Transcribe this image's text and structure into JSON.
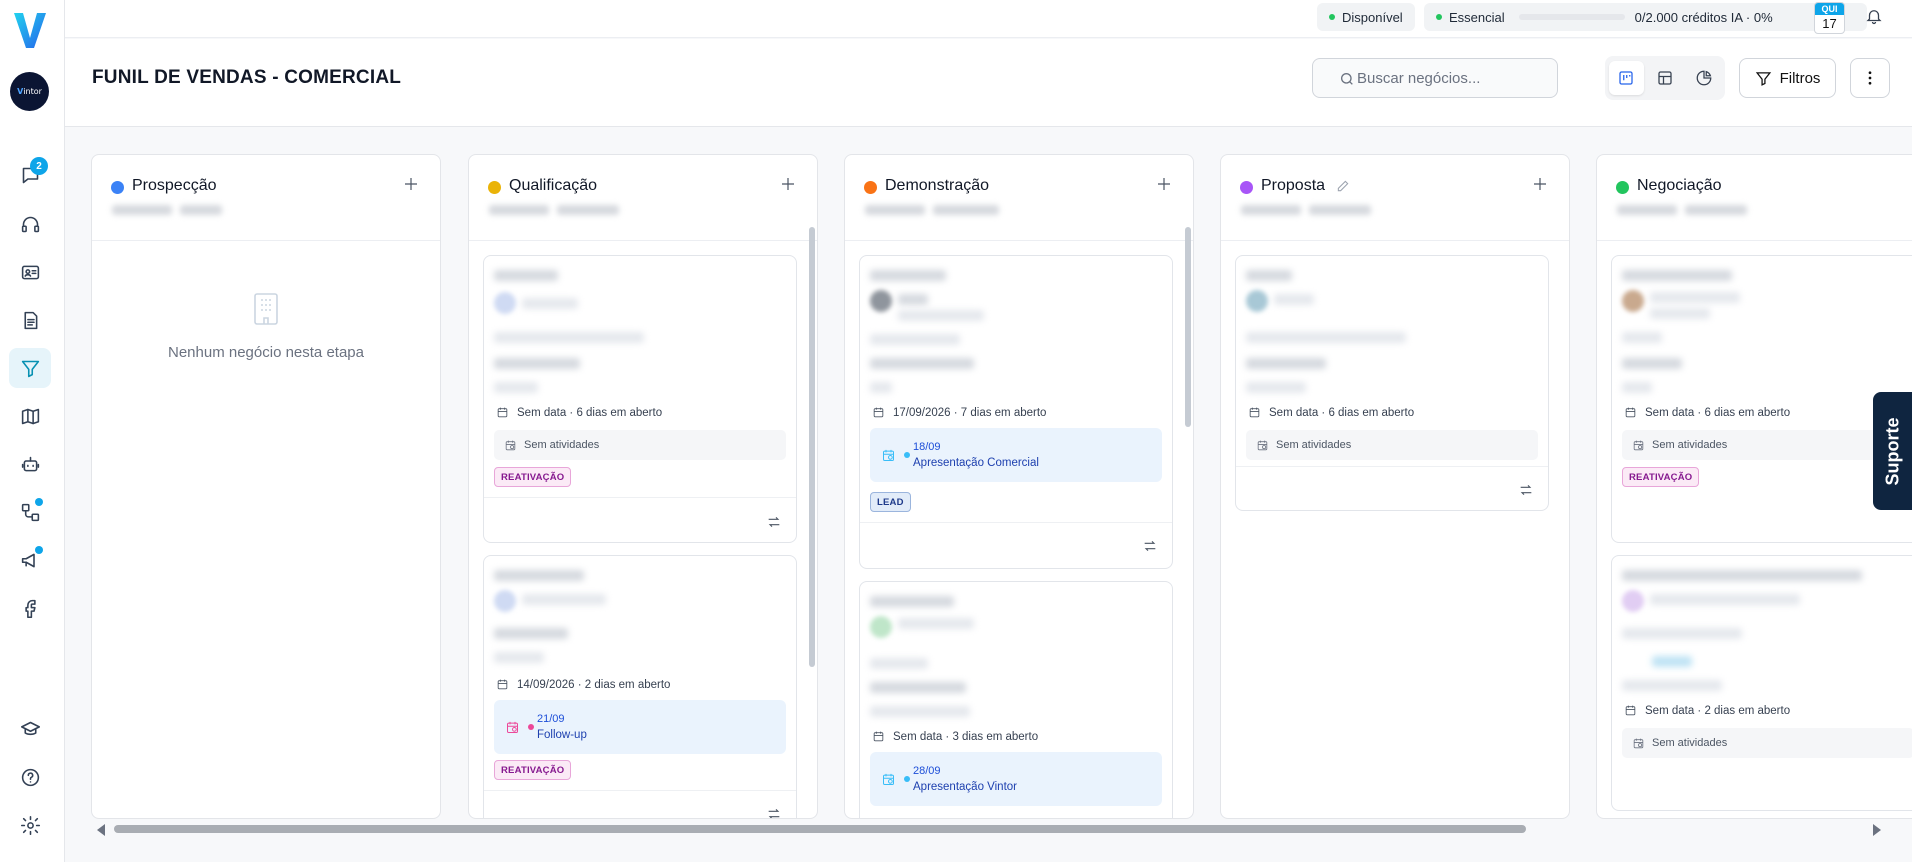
{
  "topbar": {
    "status_label": "Disponível",
    "plan_label": "Essencial",
    "credits_label": "0/2.000 créditos IA · 0%",
    "credits_progress": 0,
    "date_weekday": "QUI",
    "date_day": "17"
  },
  "sidebar": {
    "avatar_text_1": "V",
    "avatar_text_2": "intor",
    "notification_count": "2"
  },
  "header": {
    "title": "FUNIL DE VENDAS - COMERCIAL",
    "search_placeholder": "Buscar negócios...",
    "filters_label": "Filtros"
  },
  "columns": [
    {
      "title": "Prospecção",
      "color": "#3b82f6",
      "empty_text": "Nenhum negócio nesta etapa"
    },
    {
      "title": "Qualificação",
      "color": "#eab308"
    },
    {
      "title": "Demonstração",
      "color": "#f97316"
    },
    {
      "title": "Proposta",
      "color": "#a855f7"
    },
    {
      "title": "Negociação",
      "color": "#22c55e"
    }
  ],
  "cards": {
    "qual_1": {
      "meta": "Sem data · 6 dias em aberto",
      "activity": "Sem atividades",
      "tag": "REATIVAÇÃO"
    },
    "qual_2": {
      "meta": "14/09/2026 · 2 dias em aberto",
      "event_date": "21/09",
      "event_title": "Follow-up",
      "tag": "REATIVAÇÃO"
    },
    "demo_1": {
      "meta": "17/09/2026 · 7 dias em aberto",
      "event_date": "18/09",
      "event_title": "Apresentação Comercial",
      "tag": "LEAD"
    },
    "demo_2": {
      "meta": "Sem data · 3 dias em aberto",
      "event_date": "28/09",
      "event_title": "Apresentação Vintor"
    },
    "prop_1": {
      "meta": "Sem data · 6 dias em aberto",
      "activity": "Sem atividades"
    },
    "neg_1": {
      "meta": "Sem data · 6 dias em aberto",
      "activity": "Sem atividades",
      "tag": "REATIVAÇÃO"
    },
    "neg_2": {
      "meta": "Sem data · 2 dias em aberto",
      "activity": "Sem atividades"
    }
  },
  "support_label": "Suporte",
  "colors": {
    "accent": "#0ea5e9",
    "active_nav": "#0891b2",
    "support_bg": "#0f2540"
  }
}
